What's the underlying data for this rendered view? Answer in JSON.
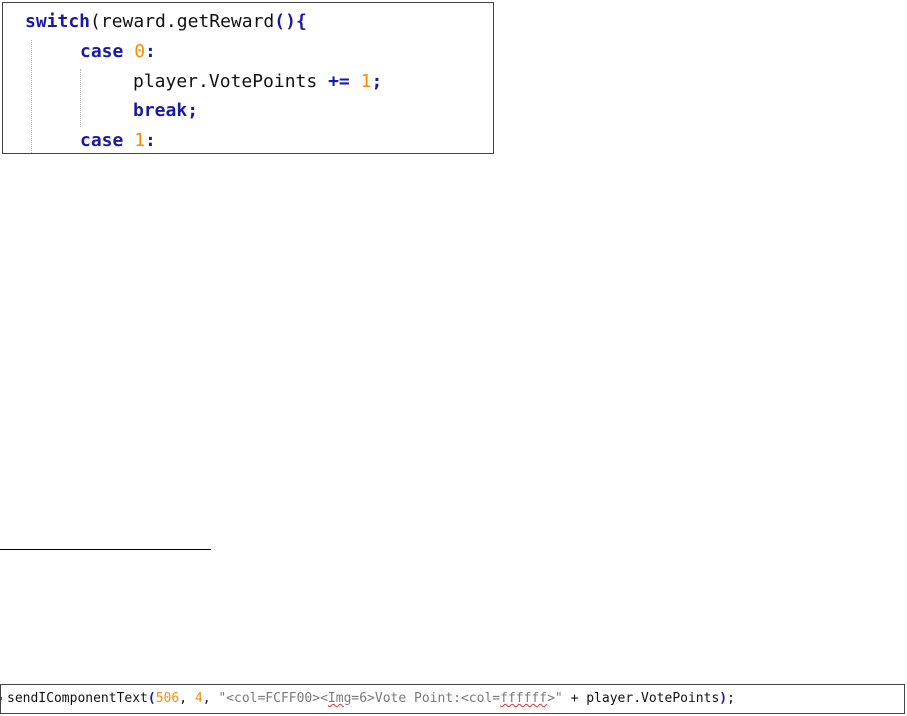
{
  "snippet1": {
    "line1": {
      "kw": "switch",
      "rest": "(reward.getReward",
      "parens": "()",
      "brace": "{"
    },
    "line2": {
      "kw": "case",
      "num": "0",
      "colon": ":"
    },
    "line3": {
      "text": "player.VotePoints ",
      "op": "+=",
      "num": "1",
      "semi": ";"
    },
    "line4": {
      "kw": "break",
      "semi": ";"
    },
    "line5": {
      "kw": "case",
      "num": "1",
      "colon": ":"
    }
  },
  "snippet2": {
    "func": "sendIComponentText",
    "paren_open": "(",
    "arg1": "506",
    "comma1": ", ",
    "arg2": "4",
    "comma2": ", ",
    "str_a": "\"<col=FCFF00><",
    "str_img": "Img",
    "str_b": "=6>Vote Point:<col=",
    "str_hex": "ffffff",
    "str_c": ">\"",
    "concat": " + player.VotePoints",
    "paren_close": ")",
    "semi": ";"
  },
  "colors": {
    "keyword": "#1a1aa6",
    "number": "#ff8c00",
    "string": "#7a7a7a",
    "error_squiggle": "#e03030"
  }
}
